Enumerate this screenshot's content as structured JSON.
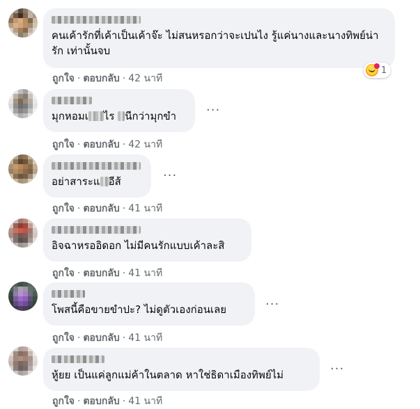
{
  "labels": {
    "like": "ถูกใจ",
    "reply": "ตอบกลับ",
    "separator": "·",
    "more": "···"
  },
  "comments": [
    {
      "text": "คนเค้ารักที่เค้าเป็นเค้าจ๊ะ ไม่สนหรอกว่าจะเปนไง รู้แค่นางและนางทิพย์น่ารัก เท่านั้นจบ",
      "time": "42 นาที",
      "reaction_count": "1",
      "reaction_icon": "hugging-face-icon"
    },
    {
      "text_a": "มุกหอมเ",
      "text_b": "ไร",
      "text_c": "นีกว่ามุกขำ",
      "time": "42 นาที"
    },
    {
      "text_a": "อย่าสาระแ",
      "text_b": "อีส้",
      "time": "41 นาที"
    },
    {
      "text": "อิจฉาหรออิดอก ไม่มีคนรักแบบเค้าละสิ",
      "time": "41 นาที"
    },
    {
      "text": "โพสนี้คือขายขำปะ? ไม่ดูตัวเองก่อนเลย",
      "time": "41 นาที"
    },
    {
      "text": "หู้ยย เป็นแค่ลูกแม่ค้าในตลาด หาใช่ธิดาเมืองทิพย์ไม่",
      "time": "41 นาที"
    }
  ],
  "colors": {
    "bubble": "#f0f2f5",
    "meta": "#65676b",
    "text": "#050505"
  }
}
